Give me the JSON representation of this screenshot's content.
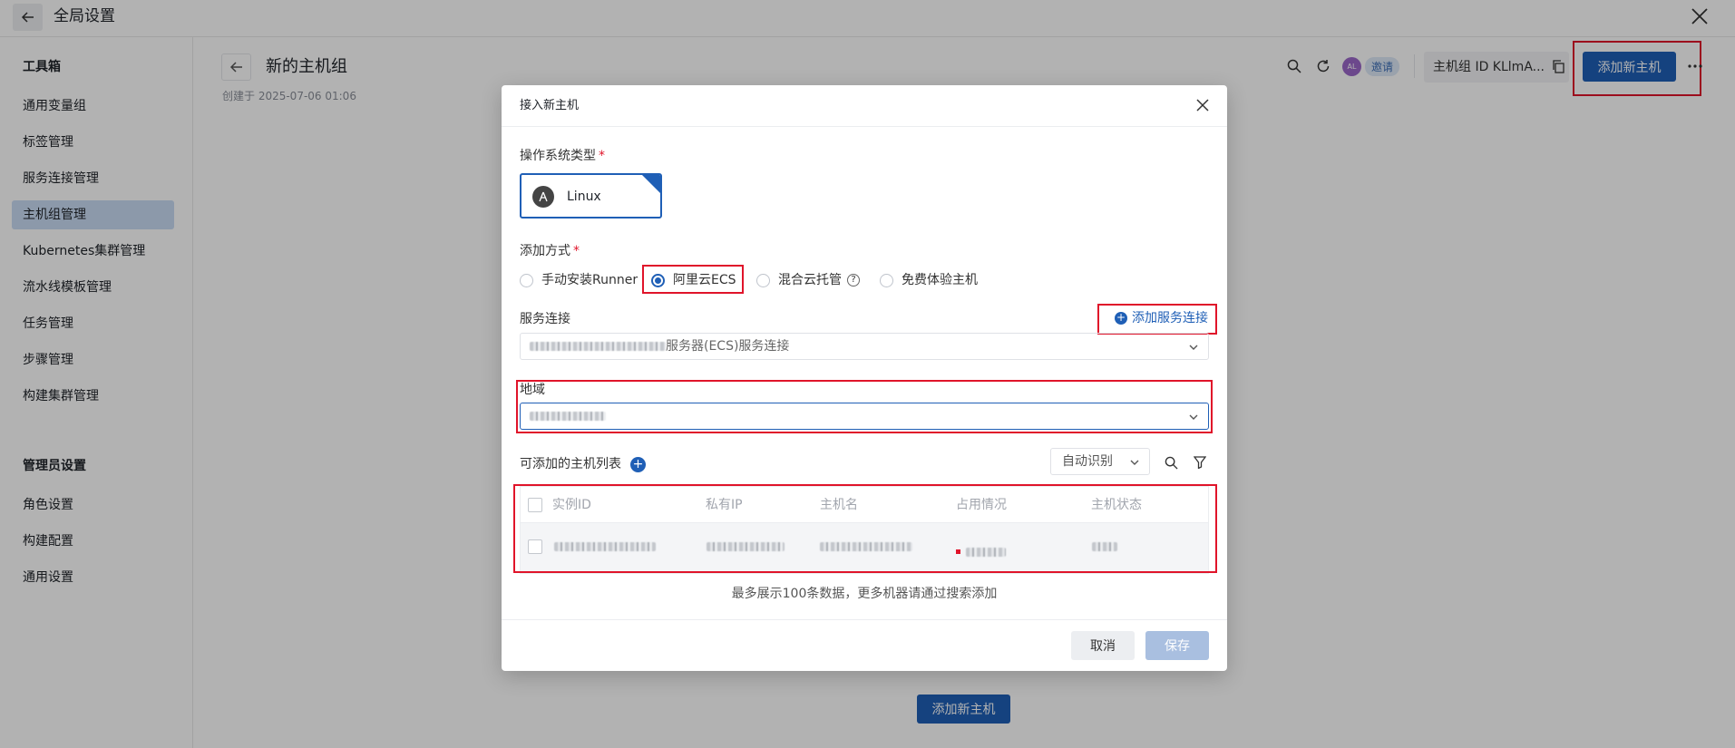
{
  "app": {
    "title": "全局设置"
  },
  "sidebar": {
    "sections": [
      {
        "title": "工具箱",
        "items": [
          "通用变量组",
          "标签管理",
          "服务连接管理",
          "主机组管理",
          "Kubernetes集群管理",
          "流水线模板管理",
          "任务管理",
          "步骤管理",
          "构建集群管理"
        ]
      },
      {
        "title": "管理员设置",
        "items": [
          "角色设置",
          "构建配置",
          "通用设置"
        ]
      }
    ],
    "active_item": "主机组管理"
  },
  "header": {
    "title": "新的主机组",
    "created": "创建于 2025-07-06 01:06",
    "avatar_initials": "AL",
    "invite_label": "邀请",
    "group_id": "主机组 ID KLlmA...",
    "add_host_label": "添加新主机"
  },
  "empty_state": {
    "add_host_label": "添加新主机"
  },
  "modal": {
    "title": "接入新主机",
    "os_type_label": "操作系统类型",
    "os_selected": "Linux",
    "add_method_label": "添加方式",
    "methods": [
      "手动安装Runner",
      "阿里云ECS",
      "混合云托管",
      "免费体验主机"
    ],
    "selected_method": "阿里云ECS",
    "service_conn_label": "服务连接",
    "add_service_conn": "添加服务连接",
    "service_conn_suffix": "服务器(ECS)服务连接",
    "region_label": "地域",
    "host_list_label": "可添加的主机列表",
    "auto_detect": "自动识别",
    "columns": [
      "实例ID",
      "私有IP",
      "主机名",
      "占用情况",
      "主机状态"
    ],
    "note": "最多展示100条数据，更多机器请通过搜索添加",
    "cancel": "取消",
    "save": "保存"
  },
  "colors": {
    "primary": "#1f5fb6",
    "highlight": "#e0142a"
  }
}
